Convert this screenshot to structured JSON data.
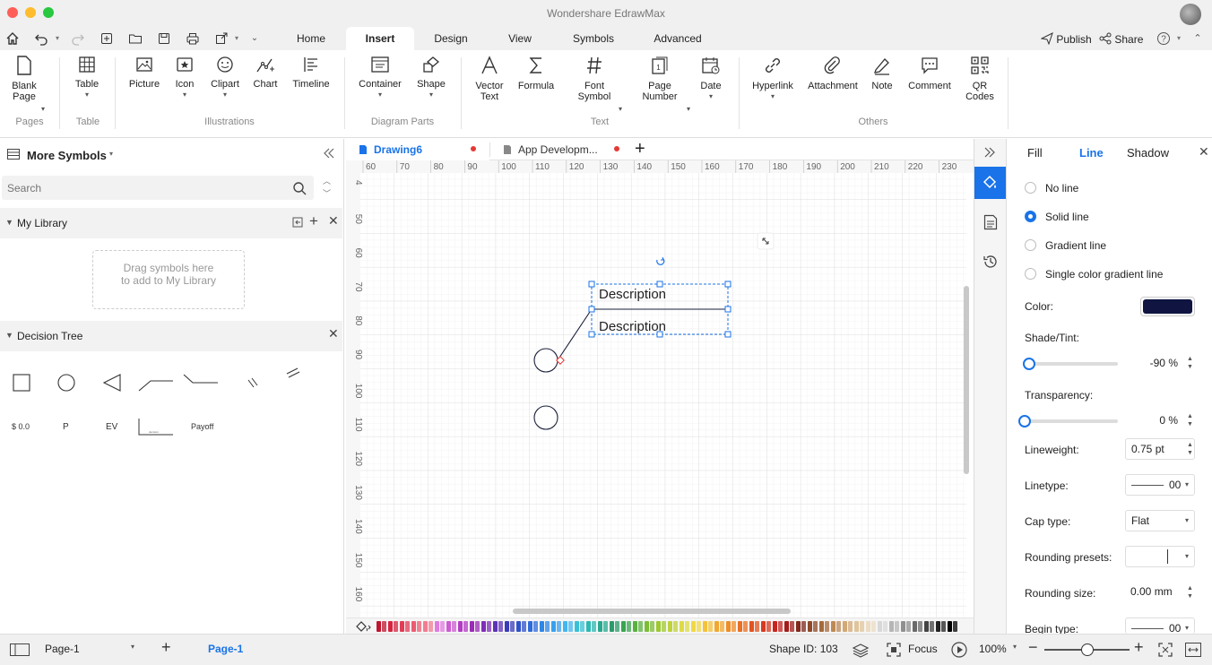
{
  "app": {
    "title": "Wondershare EdrawMax"
  },
  "menu_tabs": [
    {
      "label": "Home"
    },
    {
      "label": "Insert"
    },
    {
      "label": "Design"
    },
    {
      "label": "View"
    },
    {
      "label": "Symbols"
    },
    {
      "label": "Advanced"
    }
  ],
  "menu_right": {
    "publish": "Publish",
    "share": "Share"
  },
  "ribbon": {
    "buttons": {
      "blank_page": "Blank Page",
      "table": "Table",
      "picture": "Picture",
      "icon": "Icon",
      "clipart": "Clipart",
      "chart": "Chart",
      "timeline": "Timeline",
      "container": "Container",
      "shape": "Shape",
      "vector_text": "Vector Text",
      "formula": "Formula",
      "font_symbol": "Font Symbol",
      "page_number": "Page Number",
      "date": "Date",
      "hyperlink": "Hyperlink",
      "attachment": "Attachment",
      "note": "Note",
      "comment": "Comment",
      "qr_codes": "QR Codes"
    },
    "groups": {
      "pages": "Pages",
      "table": "Table",
      "illustrations": "Illustrations",
      "diagram_parts": "Diagram Parts",
      "text": "Text",
      "others": "Others"
    }
  },
  "left_panel": {
    "title": "More Symbols",
    "search_placeholder": "Search",
    "my_library": "My Library",
    "drop_hint": "Drag symbols here to add to My Library",
    "decision_tree": "Decision Tree",
    "shape_labels": [
      "$ 0.0",
      "P",
      "EV",
      "Payoff"
    ]
  },
  "doc_tabs": [
    {
      "label": "Drawing6"
    },
    {
      "label": "App Developm..."
    }
  ],
  "ruler": {
    "h": [
      "60",
      "70",
      "80",
      "90",
      "100",
      "110",
      "120",
      "130",
      "140",
      "150",
      "160",
      "170",
      "180",
      "190",
      "200",
      "210",
      "220",
      "230"
    ],
    "v": [
      "4",
      "50",
      "60",
      "70",
      "80",
      "90",
      "100",
      "110",
      "120",
      "130",
      "140",
      "150",
      "160"
    ]
  },
  "canvas": {
    "label1": "Description",
    "label2": "Description"
  },
  "right_panel": {
    "tabs": {
      "fill": "Fill",
      "line": "Line",
      "shadow": "Shadow"
    },
    "options": [
      "No line",
      "Solid line",
      "Gradient line",
      "Single color gradient line"
    ],
    "selected_option": "Solid line",
    "color_label": "Color:",
    "color_value": "#0f1540",
    "shade_label": "Shade/Tint:",
    "shade_value": "-90 %",
    "shade_level": 0.05,
    "transparency_label": "Transparency:",
    "transparency_value": "0 %",
    "transparency_level": 0,
    "lineweight_label": "Lineweight:",
    "lineweight_value": "0.75 pt",
    "linetype_label": "Linetype:",
    "linetype_value": "00",
    "cap_label": "Cap type:",
    "cap_value": "Flat",
    "rounding_presets_label": "Rounding presets:",
    "rounding_size_label": "Rounding size:",
    "rounding_size_value": "0.00 mm",
    "begin_type_label": "Begin type:",
    "begin_type_value": "00"
  },
  "status": {
    "page_select": "Page-1",
    "page_tab": "Page-1",
    "shape_id": "Shape ID: 103",
    "focus": "Focus",
    "zoom": "100%",
    "zoom_level": 0.5
  },
  "colors": {
    "accent": "#1a73e8",
    "palette": [
      "#c0152f",
      "#d6243f",
      "#e23b56",
      "#ec5b72",
      "#f27c92",
      "#e07be0",
      "#cd5bd2",
      "#b43bc4",
      "#9a2bb6",
      "#7e2eb8",
      "#5d33b5",
      "#3a3db8",
      "#2f52c8",
      "#2d6bd9",
      "#2f86e6",
      "#3aa0ee",
      "#44b6ef",
      "#38c1d6",
      "#2cb8b3",
      "#27a98f",
      "#2b9b6b",
      "#3aa451",
      "#5ab13f",
      "#7cbd35",
      "#9ec930",
      "#bfd23a",
      "#dcdb44",
      "#efd845",
      "#f4c23b",
      "#f2a830",
      "#ef8d28",
      "#ea7023",
      "#e05421",
      "#d63a20",
      "#c7241f",
      "#a31d1a",
      "#7f2a1c",
      "#8e4a2a",
      "#a56a3c",
      "#bd8a55",
      "#d2a874",
      "#e0c49a",
      "#ebdcc2",
      "#d8d8d8",
      "#b5b5b5",
      "#8f8f8f",
      "#6a6a6a",
      "#444444",
      "#222222",
      "#000000"
    ]
  }
}
